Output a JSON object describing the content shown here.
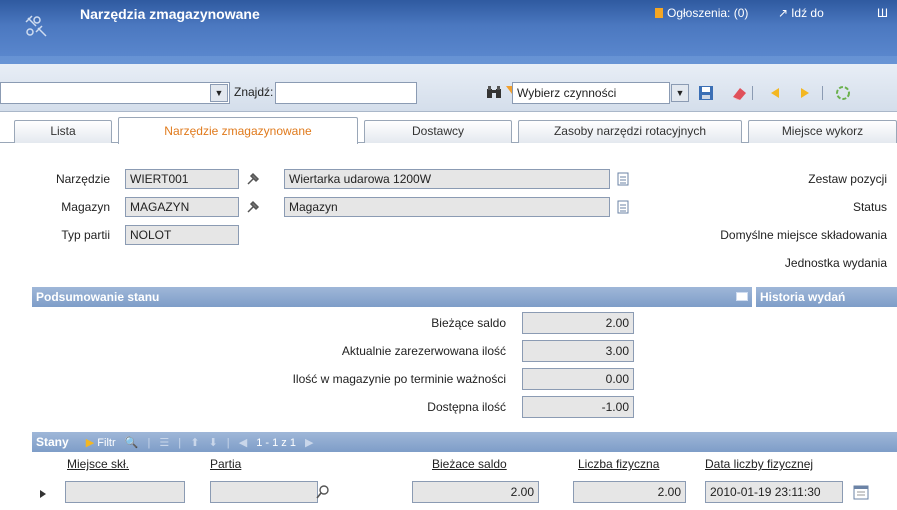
{
  "header": {
    "title": "Narzędzia zmagazynowane",
    "announcements": "Ogłoszenia: (0)",
    "goto": "Idź do",
    "more": "Ш"
  },
  "toolbar": {
    "find_label": "Znajdź:",
    "find_value": "",
    "action_select": "Wybierz czynności"
  },
  "tabs": [
    {
      "label": "Lista"
    },
    {
      "label": "Narzędzie zmagazynowane"
    },
    {
      "label": "Dostawcy"
    },
    {
      "label": "Zasoby narzędzi rotacyjnych"
    },
    {
      "label": "Miejsce wykorz"
    }
  ],
  "form": {
    "tool_label": "Narzędzie",
    "tool_value": "WIERT001",
    "tool_desc": "Wiertarka udarowa 1200W",
    "warehouse_label": "Magazyn",
    "warehouse_value": "MAGAZYN",
    "warehouse_desc": "Magazyn",
    "lot_label": "Typ partii",
    "lot_value": "NOLOT",
    "right_labels": [
      "Zestaw pozycji",
      "Status",
      "Domyślne miejsce składowania",
      "Jednostka wydania"
    ]
  },
  "summary": {
    "title": "Podsumowanie stanu",
    "history_title": "Historia wydań",
    "rows": [
      {
        "label": "Bieżące saldo",
        "value": "2.00"
      },
      {
        "label": "Aktualnie zarezerwowana ilość",
        "value": "3.00"
      },
      {
        "label": "Ilość w magazynie po terminie ważności",
        "value": "0.00"
      },
      {
        "label": "Dostępna ilość",
        "value": "-1.00"
      }
    ]
  },
  "stany": {
    "title": "Stany",
    "filter": "Filtr",
    "paging": "1 - 1 z 1",
    "columns": [
      "Miejsce skł.",
      "Partia",
      "Bieżace saldo",
      "Liczba fizyczna",
      "Data liczby fizycznej"
    ],
    "row": {
      "location": "",
      "lot": "",
      "balance": "2.00",
      "physical": "2.00",
      "date": "2010-01-19 23:11:30"
    }
  }
}
